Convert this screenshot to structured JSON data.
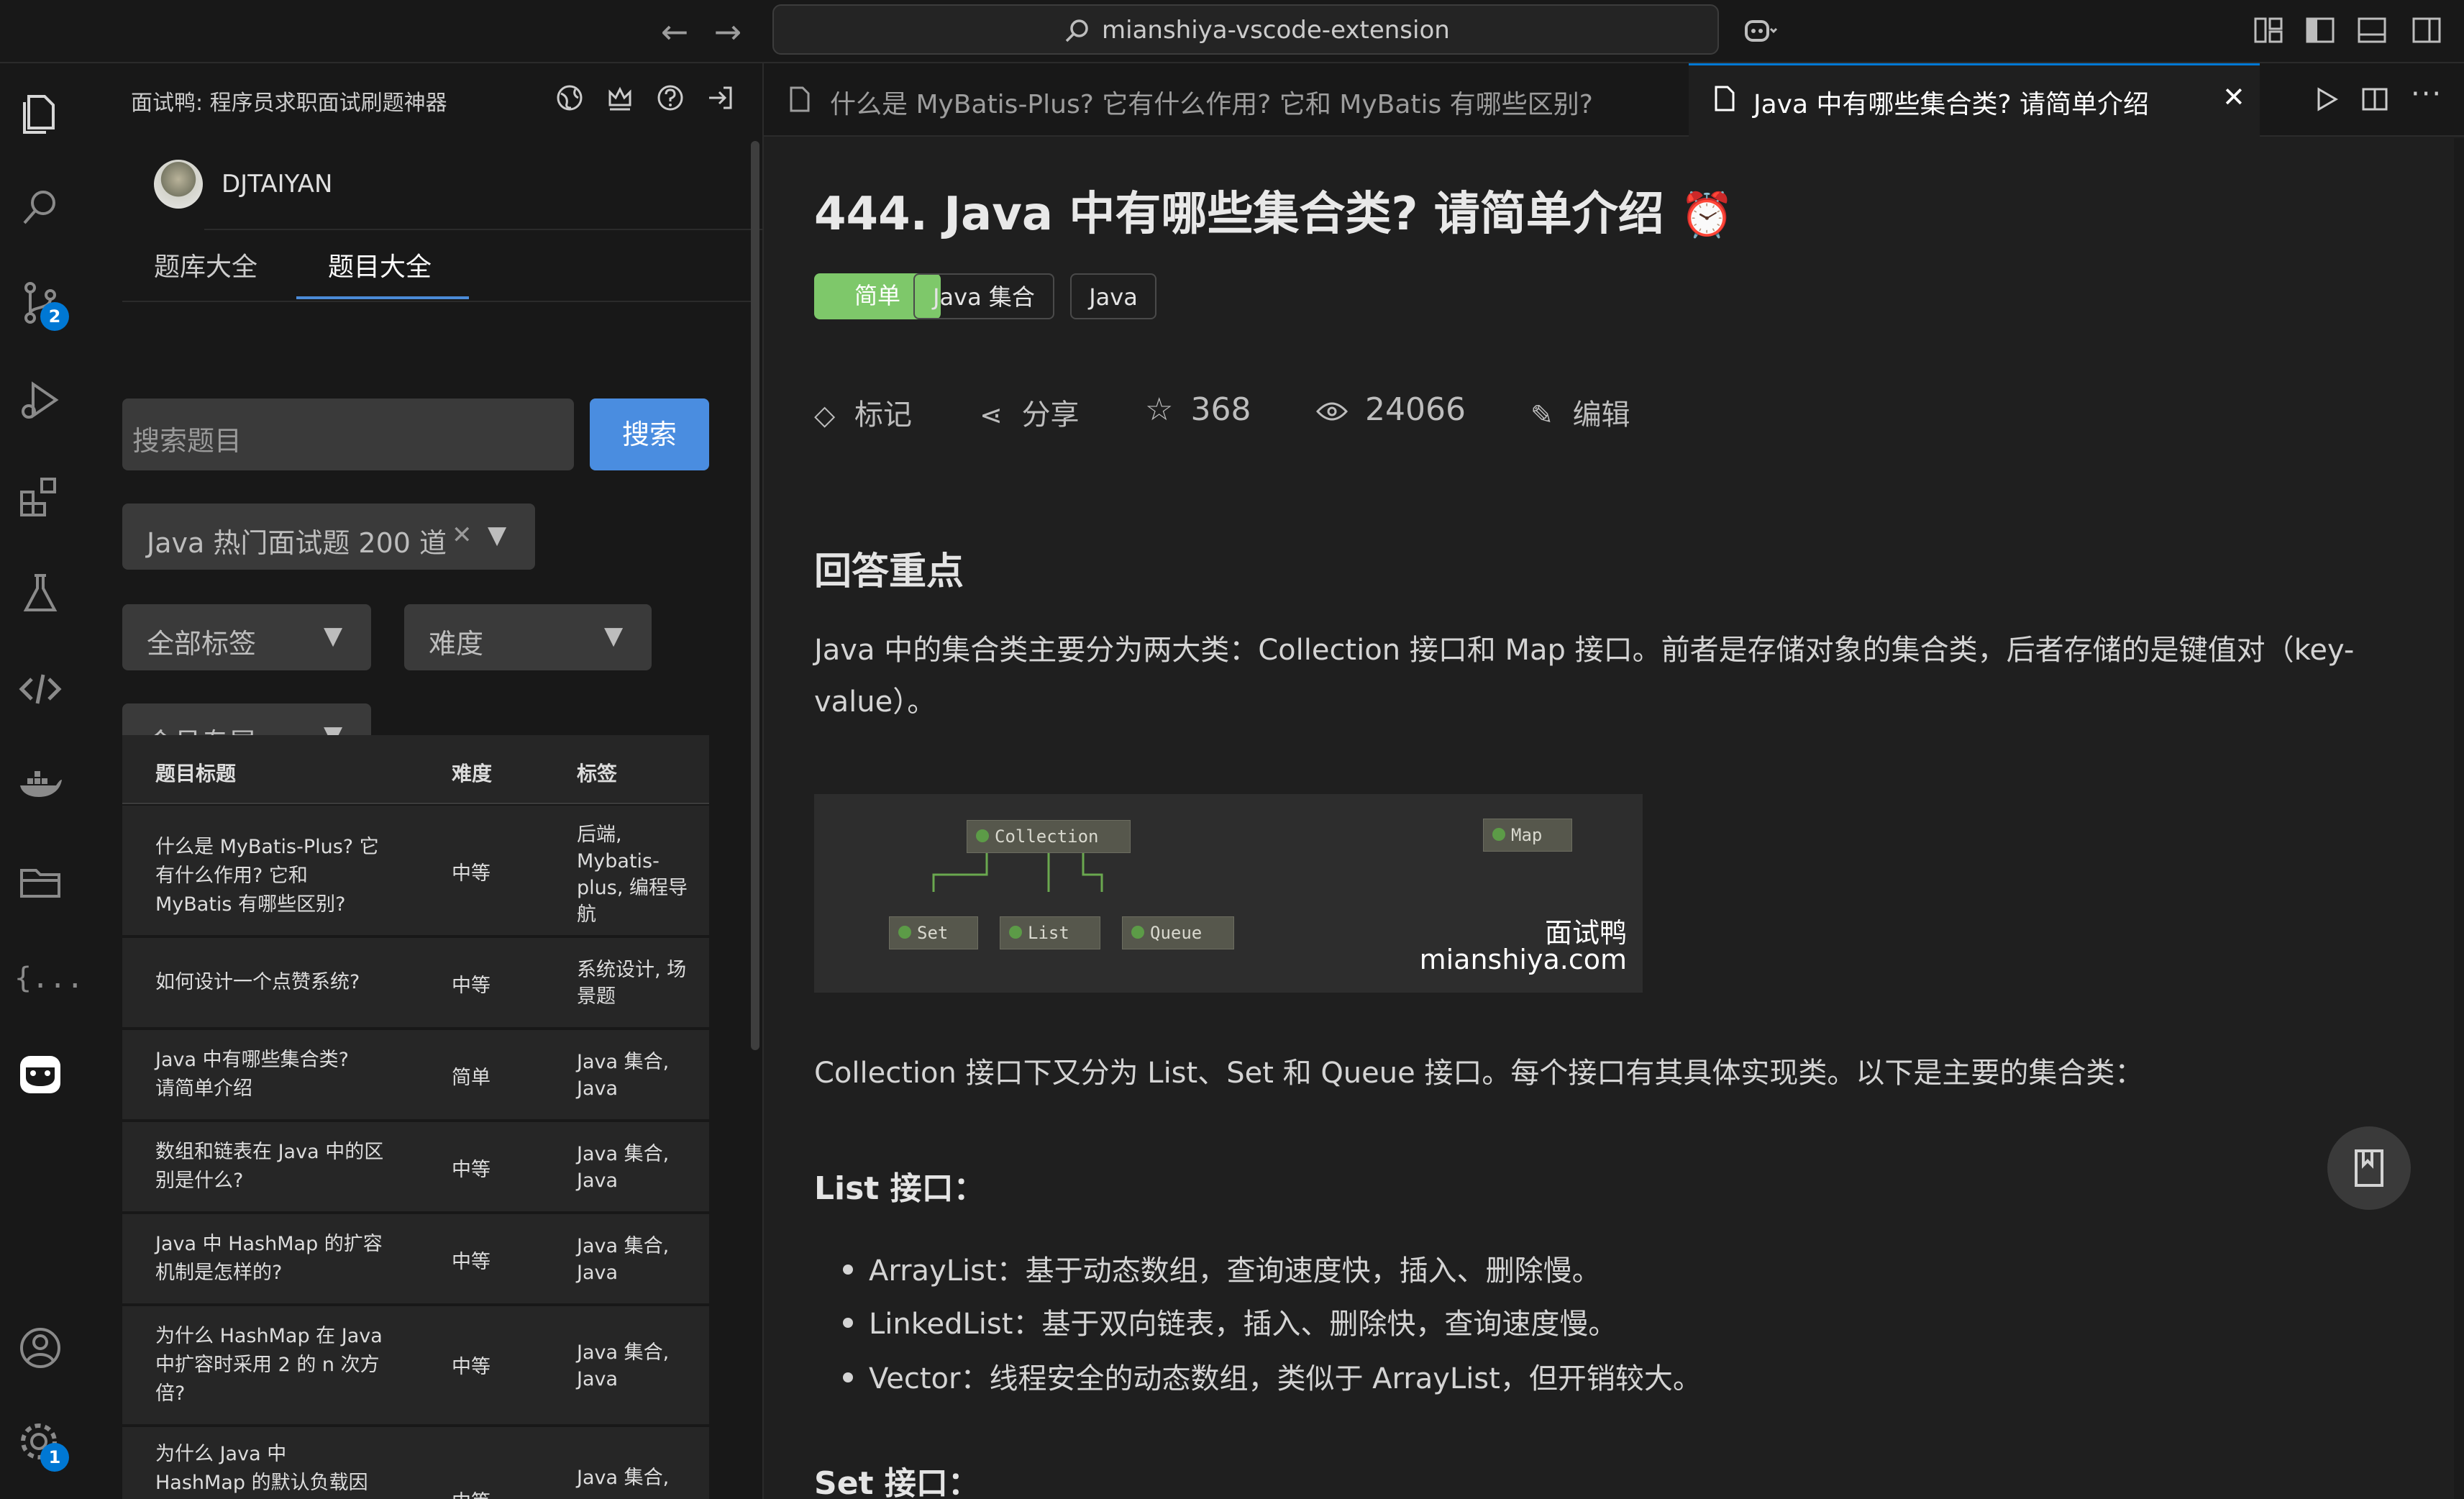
{
  "titlebar": {
    "back_icon": "arrow-left-icon",
    "forward_icon": "arrow-right-icon",
    "search_text": "mianshiya-vscode-extension",
    "copilot_icon": "copilot-icon"
  },
  "activity_bar": {
    "items": [
      {
        "name": "explorer-icon"
      },
      {
        "name": "search-icon"
      },
      {
        "name": "source-control-icon",
        "badge": "2"
      },
      {
        "name": "run-debug-icon"
      },
      {
        "name": "extensions-icon"
      },
      {
        "name": "testing-icon"
      },
      {
        "name": "remote-icon"
      },
      {
        "name": "docker-icon"
      },
      {
        "name": "folder-icon"
      },
      {
        "name": "json-icon"
      },
      {
        "name": "mianshiya-icon"
      }
    ],
    "bottom": [
      {
        "name": "account-icon"
      },
      {
        "name": "settings-icon",
        "badge": "1"
      }
    ]
  },
  "sidebar": {
    "title": "面试鸭: 程序员求职面试刷题神器",
    "user": {
      "name": "DJTAIYAN"
    },
    "tabs": [
      {
        "label": "题库大全",
        "active": false
      },
      {
        "label": "题目大全",
        "active": true
      }
    ],
    "search": {
      "placeholder": "搜索题目",
      "button": "搜索"
    },
    "bank_filter": {
      "label": "Java 热门面试题 200 道",
      "clear": "✕",
      "caret": "▼"
    },
    "tag_filter": {
      "label": "全部标签",
      "caret": "▼"
    },
    "difficulty_filter": {
      "label": "难度",
      "caret": "▼"
    },
    "member_filter": {
      "label": "会员专属",
      "caret": "▼"
    },
    "table": {
      "headers": [
        "题目标题",
        "难度",
        "标签"
      ],
      "rows": [
        {
          "title": "什么是 MyBatis-Plus? 它有什么作用? 它和 MyBatis 有哪些区别?",
          "difficulty": "中等",
          "tags": "后端, Mybatis-plus, 编程导航"
        },
        {
          "title": "如何设计一个点赞系统?",
          "difficulty": "中等",
          "tags": "系统设计, 场景题"
        },
        {
          "title": "Java 中有哪些集合类? 请简单介绍",
          "difficulty": "简单",
          "tags": "Java 集合, Java"
        },
        {
          "title": "数组和链表在 Java 中的区别是什么?",
          "difficulty": "中等",
          "tags": "Java 集合, Java"
        },
        {
          "title": "Java 中 HashMap 的扩容机制是怎样的?",
          "difficulty": "中等",
          "tags": "Java 集合, Java"
        },
        {
          "title": "为什么 HashMap 在 Java 中扩容时采用 2 的 n 次方倍?",
          "difficulty": "中等",
          "tags": "Java 集合, Java"
        },
        {
          "title": "为什么 Java 中 HashMap 的默认负载因子",
          "difficulty": "中等",
          "tags": "Java 集合,"
        }
      ]
    }
  },
  "editor": {
    "tabs": [
      {
        "label": "什么是 MyBatis-Plus? 它有什么作用? 它和 MyBatis 有哪些区别?",
        "active": false
      },
      {
        "label": "Java 中有哪些集合类? 请简单介绍",
        "active": true
      }
    ],
    "actions": [
      "run-icon",
      "split-editor-icon",
      "more-icon"
    ]
  },
  "question": {
    "title": "444. Java 中有哪些集合类? 请简单介绍",
    "title_icon": "⏰",
    "tags": [
      {
        "label": "简单",
        "color": "#7ec86a"
      },
      {
        "label": "Java 集合"
      },
      {
        "label": "Java"
      }
    ],
    "actions": {
      "mark": "标记",
      "share": "分享",
      "stars": "368",
      "views": "24066",
      "edit": "编辑"
    },
    "section_title": "回答重点",
    "intro": "Java 中的集合类主要分为两大类：Collection 接口和 Map 接口。前者是存储对象的集合类，后者存储的是键值对（key-value）。",
    "diagram": {
      "nodes": [
        "Collection",
        "Map",
        "Set",
        "List",
        "Queue"
      ],
      "watermark_name": "面试鸭",
      "watermark_url": "mianshiya.com"
    },
    "para2": "Collection 接口下又分为 List、Set 和 Queue 接口。每个接口有其具体实现类。以下是主要的集合类：",
    "list_heading": "List 接口：",
    "list_items": [
      "ArrayList：基于动态数组，查询速度快，插入、删除慢。",
      "LinkedList：基于双向链表，插入、删除快，查询速度慢。",
      "Vector：线程安全的动态数组，类似于 ArrayList，但开销较大。"
    ],
    "set_heading": "Set 接口："
  },
  "colors": {
    "accent": "#0078d4",
    "search_button": "#4a8de0",
    "easy_tag": "#7ec86a"
  }
}
